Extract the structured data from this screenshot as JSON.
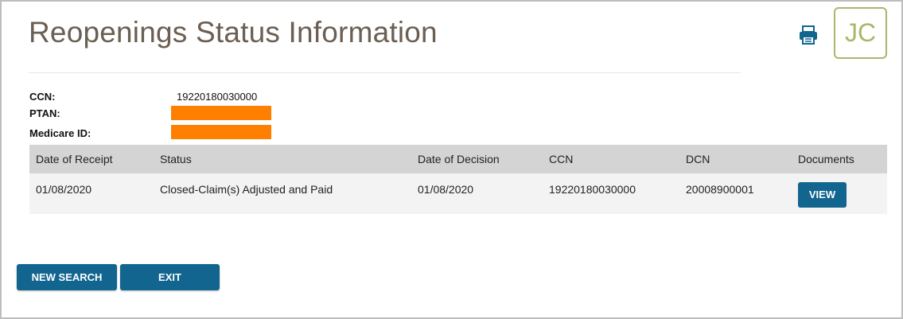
{
  "header": {
    "title": "Reopenings Status Information",
    "avatar_initials": "JC",
    "print_icon": "printer-icon"
  },
  "info": {
    "ccn_label": "CCN:",
    "ccn_value": "19220180030000",
    "ptan_label": "PTAN:",
    "medicare_id_label": "Medicare ID:"
  },
  "table": {
    "columns": [
      "Date of Receipt",
      "Status",
      "Date of Decision",
      "CCN",
      "DCN",
      "Documents"
    ],
    "rows": [
      {
        "date_of_receipt": "01/08/2020",
        "status": "Closed-Claim(s) Adjusted and Paid",
        "date_of_decision": "01/08/2020",
        "ccn": "19220180030000",
        "dcn": "20008900001",
        "documents_button": "VIEW"
      }
    ]
  },
  "actions": {
    "new_search_label": "NEW SEARCH",
    "exit_label": "EXIT"
  },
  "colors": {
    "title": "#6b5e52",
    "button": "#11658f",
    "redaction": "#ff8000",
    "avatar": "#a8b86a",
    "header_row": "#d4d4d4",
    "data_row": "#f3f3f3"
  }
}
